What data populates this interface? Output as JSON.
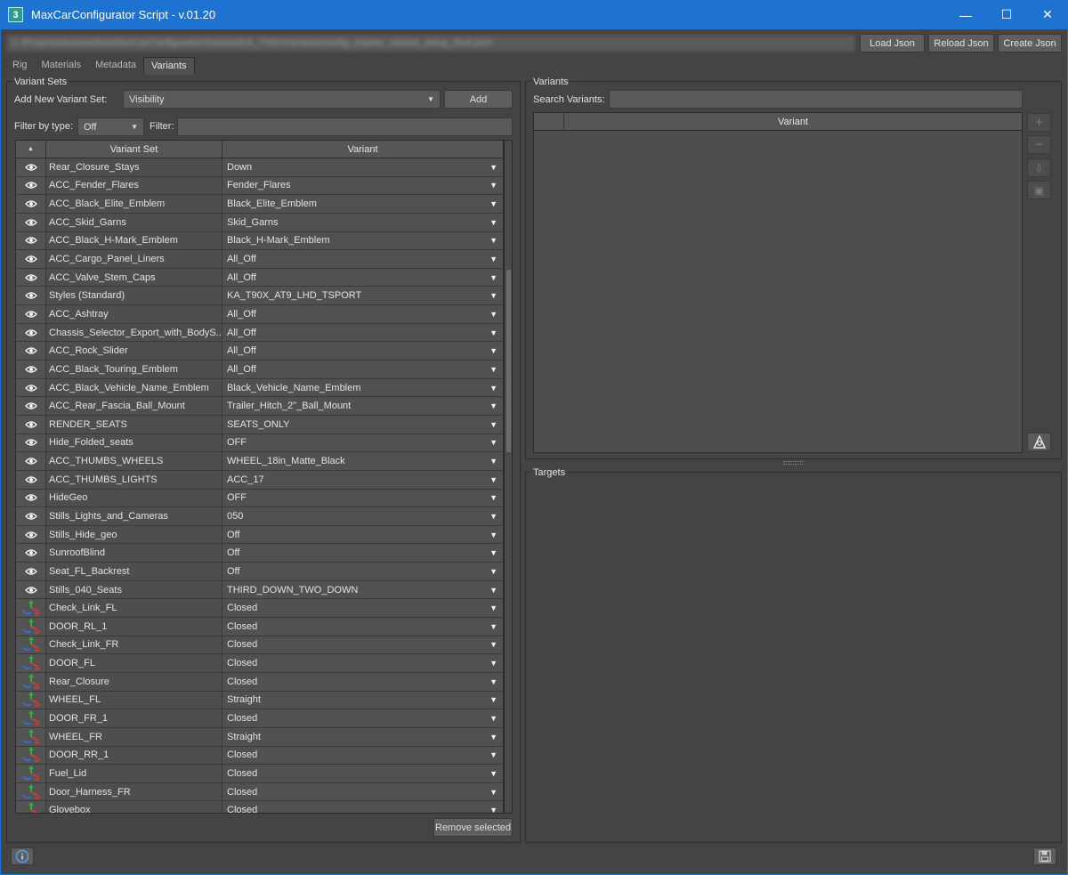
{
  "window": {
    "title": "MaxCarConfigurator Script - v.01.20",
    "app_icon_label": "3",
    "minimize": "—",
    "maximize": "☐",
    "close": "✕"
  },
  "path_field": "C:\\Projects\\Automotive\\MaxCarConfigurator\\Scenes\\KA_T90X\\Variants\\config_master_variant_setup_final.json",
  "buttons": {
    "load_json": "Load Json",
    "reload_json": "Reload Json",
    "create_json": "Create Json",
    "add": "Add",
    "remove_selected": "Remove selected"
  },
  "tabs": [
    {
      "label": "Rig"
    },
    {
      "label": "Materials"
    },
    {
      "label": "Metadata"
    },
    {
      "label": "Variants",
      "active": true
    }
  ],
  "variant_sets_panel": {
    "title": "Variant Sets",
    "add_label": "Add New Variant Set:",
    "add_combo_value": "Visibility",
    "filter_by_type_label": "Filter by type:",
    "filter_type_value": "Off",
    "filter_label": "Filter:",
    "filter_value": "",
    "columns": {
      "sort": "▲",
      "set": "Variant Set",
      "variant": "Variant"
    },
    "rows": [
      {
        "icon": "eye",
        "set": "Rear_Closure_Stays",
        "variant": "Down"
      },
      {
        "icon": "eye",
        "set": "ACC_Fender_Flares",
        "variant": "Fender_Flares"
      },
      {
        "icon": "eye",
        "set": "ACC_Black_Elite_Emblem",
        "variant": "Black_Elite_Emblem"
      },
      {
        "icon": "eye",
        "set": "ACC_Skid_Garns",
        "variant": "Skid_Garns"
      },
      {
        "icon": "eye",
        "set": "ACC_Black_H-Mark_Emblem",
        "variant": "Black_H-Mark_Emblem"
      },
      {
        "icon": "eye",
        "set": "ACC_Cargo_Panel_Liners",
        "variant": "All_Off"
      },
      {
        "icon": "eye",
        "set": "ACC_Valve_Stem_Caps",
        "variant": "All_Off"
      },
      {
        "icon": "eye",
        "set": "Styles (Standard)",
        "variant": "KA_T90X_AT9_LHD_TSPORT"
      },
      {
        "icon": "eye",
        "set": "ACC_Ashtray",
        "variant": "All_Off"
      },
      {
        "icon": "eye",
        "set": "Chassis_Selector_Export_with_BodyS...",
        "variant": "All_Off"
      },
      {
        "icon": "eye",
        "set": "ACC_Rock_Slider",
        "variant": "All_Off"
      },
      {
        "icon": "eye",
        "set": "ACC_Black_Touring_Emblem",
        "variant": "All_Off"
      },
      {
        "icon": "eye",
        "set": "ACC_Black_Vehicle_Name_Emblem",
        "variant": "Black_Vehicle_Name_Emblem"
      },
      {
        "icon": "eye",
        "set": "ACC_Rear_Fascia_Ball_Mount",
        "variant": "Trailer_Hitch_2\"_Ball_Mount"
      },
      {
        "icon": "eye",
        "set": "RENDER_SEATS",
        "variant": "SEATS_ONLY"
      },
      {
        "icon": "eye",
        "set": "Hide_Folded_seats",
        "variant": "OFF"
      },
      {
        "icon": "eye",
        "set": "ACC_THUMBS_WHEELS",
        "variant": "WHEEL_18in_Matte_Black"
      },
      {
        "icon": "eye",
        "set": "ACC_THUMBS_LIGHTS",
        "variant": "ACC_17"
      },
      {
        "icon": "eye",
        "set": "HideGeo",
        "variant": "OFF"
      },
      {
        "icon": "eye",
        "set": "Stills_Lights_and_Cameras",
        "variant": "050"
      },
      {
        "icon": "eye",
        "set": "Stills_Hide_geo",
        "variant": "Off"
      },
      {
        "icon": "eye",
        "set": "SunroofBlind",
        "variant": "Off"
      },
      {
        "icon": "eye",
        "set": "Seat_FL_Backrest",
        "variant": "Off"
      },
      {
        "icon": "eye",
        "set": "Stills_040_Seats",
        "variant": "THIRD_DOWN_TWO_DOWN"
      },
      {
        "icon": "transform",
        "set": "Check_Link_FL",
        "variant": "Closed"
      },
      {
        "icon": "transform",
        "set": "DOOR_RL_1",
        "variant": "Closed"
      },
      {
        "icon": "transform",
        "set": "Check_Link_FR",
        "variant": "Closed"
      },
      {
        "icon": "transform",
        "set": "DOOR_FL",
        "variant": "Closed"
      },
      {
        "icon": "transform",
        "set": "Rear_Closure",
        "variant": "Closed"
      },
      {
        "icon": "transform",
        "set": "WHEEL_FL",
        "variant": "Straight"
      },
      {
        "icon": "transform",
        "set": "DOOR_FR_1",
        "variant": "Closed"
      },
      {
        "icon": "transform",
        "set": "WHEEL_FR",
        "variant": "Straight"
      },
      {
        "icon": "transform",
        "set": "DOOR_RR_1",
        "variant": "Closed"
      },
      {
        "icon": "transform",
        "set": "Fuel_Lid",
        "variant": "Closed"
      },
      {
        "icon": "transform",
        "set": "Door_Harness_FR",
        "variant": "Closed"
      },
      {
        "icon": "transform",
        "set": "Glovebox",
        "variant": "Closed"
      }
    ]
  },
  "variants_panel": {
    "title": "Variants",
    "search_label": "Search Variants:",
    "search_value": "",
    "column": "Variant",
    "side_buttons": [
      "+",
      "−",
      "⇩",
      "▣"
    ]
  },
  "targets_panel": {
    "title": "Targets"
  },
  "colors": {
    "titlebar": "#1e73d0",
    "background": "#444444",
    "eye": "#f4f4f4",
    "axis_x": "#d23a3a",
    "axis_y": "#2fb33a",
    "axis_z": "#3a6ad2"
  }
}
